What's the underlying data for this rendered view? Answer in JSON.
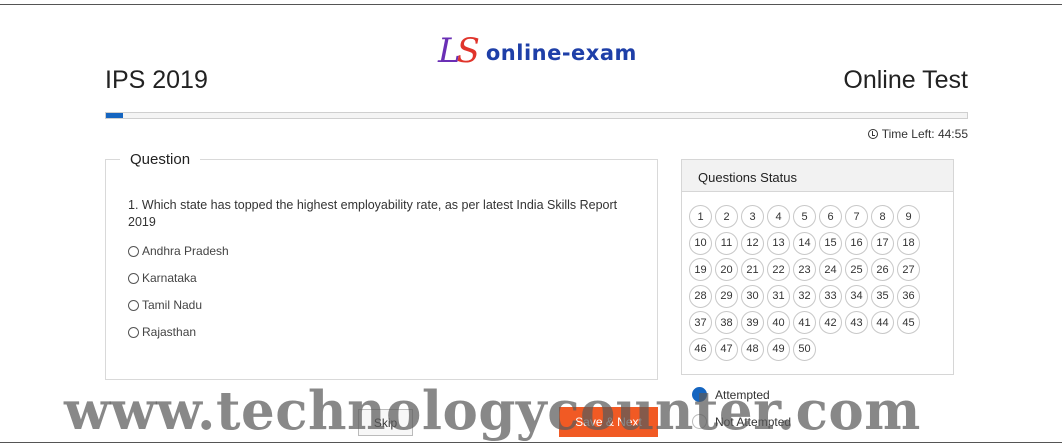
{
  "logo": {
    "mark_l": "L",
    "mark_s": "S",
    "text": "online-exam",
    "colors": {
      "l": "#6a2fb5",
      "s": "#e0342b",
      "text": "#1e3fa8"
    }
  },
  "header": {
    "exam_title": "IPS 2019",
    "test_title": "Online Test"
  },
  "progress": {
    "fraction": 0.02,
    "color": "#1565c0"
  },
  "timer": {
    "icon": "clock-icon",
    "text": "Time Left: 44:55"
  },
  "question": {
    "legend": "Question",
    "text": "1. Which state has topped the highest employability rate, as per latest India Skills Report 2019",
    "options": [
      "Andhra Pradesh",
      "Karnataka",
      "Tamil Nadu",
      "Rajasthan"
    ]
  },
  "status_panel": {
    "title": "Questions Status",
    "numbers": [
      "1",
      "2",
      "3",
      "4",
      "5",
      "6",
      "7",
      "8",
      "9",
      "10",
      "11",
      "12",
      "13",
      "14",
      "15",
      "16",
      "17",
      "18",
      "19",
      "20",
      "21",
      "22",
      "23",
      "24",
      "25",
      "26",
      "27",
      "28",
      "29",
      "30",
      "31",
      "32",
      "33",
      "34",
      "35",
      "36",
      "37",
      "38",
      "39",
      "40",
      "41",
      "42",
      "43",
      "44",
      "45",
      "46",
      "47",
      "48",
      "49",
      "50"
    ]
  },
  "legend": {
    "attempted": "Attempted",
    "not_attempted": "Not Attempted",
    "attempted_color": "#1565c0"
  },
  "buttons": {
    "skip": "Skip",
    "save_next": "Save & Next",
    "save_color": "#f15a24"
  },
  "watermark": "www.technologycounter.com"
}
